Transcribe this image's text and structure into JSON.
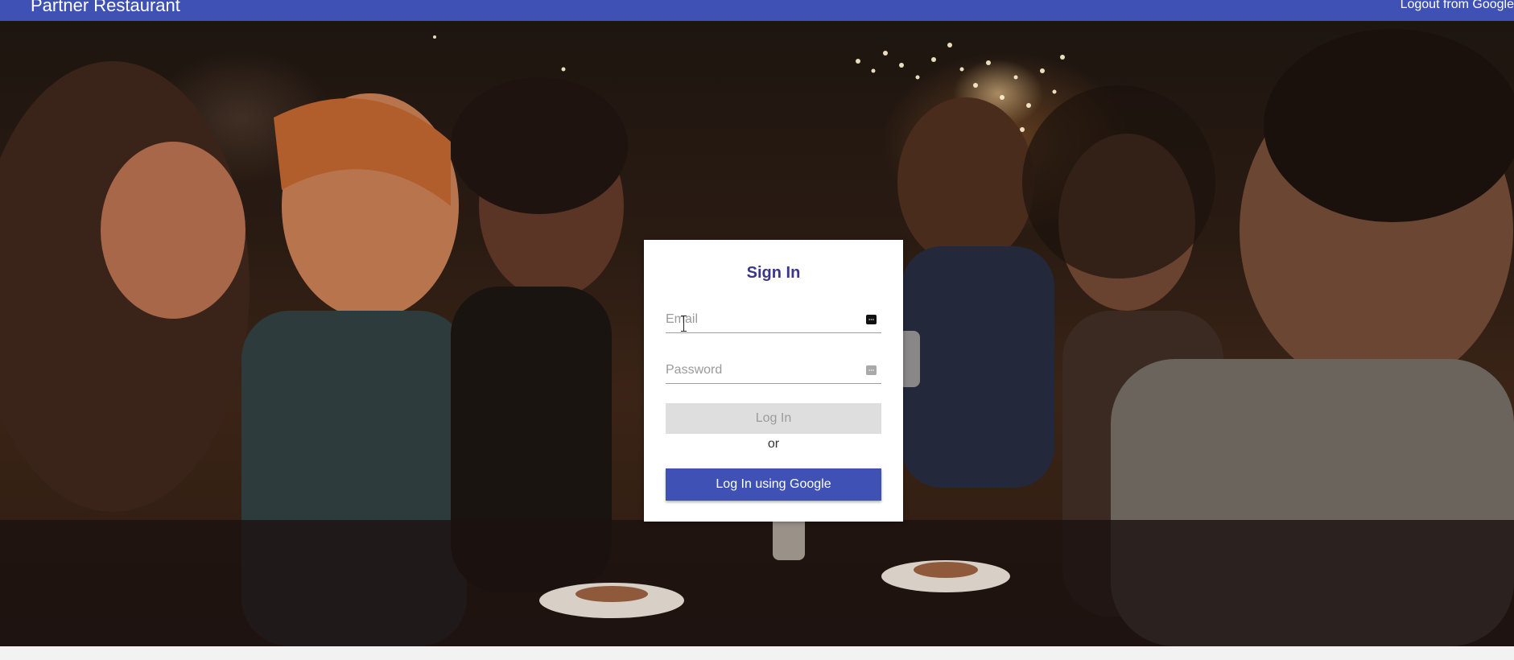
{
  "header": {
    "brand": "Partner Restaurant",
    "logout_label": "Logout from Google"
  },
  "hero": {
    "image": "restaurant-friends-dining-photo"
  },
  "signin": {
    "title": "Sign In",
    "email_placeholder": "Email",
    "email_value": "",
    "password_placeholder": "Password",
    "password_value": "",
    "login_label": "Log In",
    "or_label": "or",
    "google_label": "Log In using Google"
  },
  "colors": {
    "primary": "#3f51b5",
    "title": "#3a3688",
    "disabled_button": "#dedede"
  },
  "icons": [
    "password-manager-key-icon",
    "text-cursor-icon"
  ]
}
